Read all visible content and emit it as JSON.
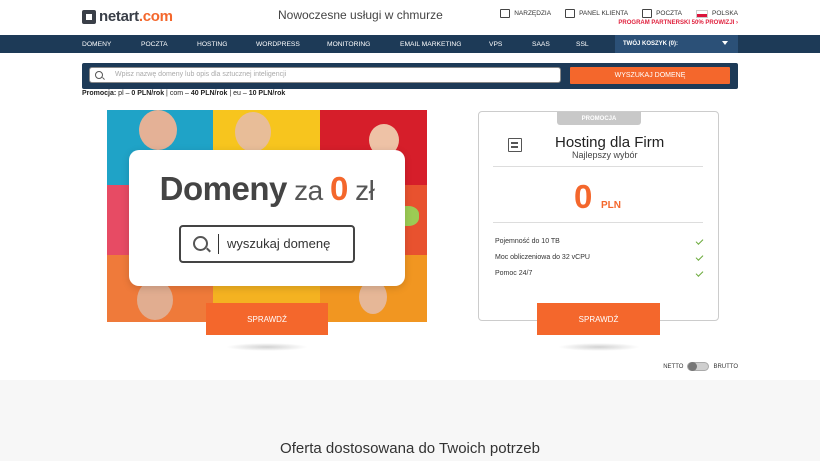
{
  "header": {
    "logo_text": "netart",
    "logo_suffix": ".com",
    "tagline": "Nowoczesne usługi w chmurze",
    "links": [
      {
        "label": "NARZĘDZIA",
        "icon": "tools-icon"
      },
      {
        "label": "PANEL KLIENTA",
        "icon": "user-icon"
      },
      {
        "label": "POCZTA",
        "icon": "mail-icon"
      },
      {
        "label": "POLSKA",
        "icon": "flag-poland-icon"
      }
    ],
    "partner_link": "PROGRAM PARTNERSKI 50% PROWIZJI ›"
  },
  "nav": {
    "items": [
      "DOMENY",
      "POCZTA",
      "HOSTING",
      "WORDPRESS",
      "MONITORING",
      "EMAIL MARKETING",
      "VPS",
      "SaaS",
      "SSL"
    ],
    "cart_label": "TWÓJ KOSZYK (0):"
  },
  "search": {
    "placeholder": "Wpisz nazwę domeny lub opis dla sztucznej inteligencji",
    "button_label": "WYSZUKAJ DOMENĘ"
  },
  "promo": {
    "label": "Promocja:",
    "text_1": " pl – ",
    "price_1": "0 PLN/rok",
    "text_2": " | com – ",
    "price_2": "40 PLN/rok",
    "text_3": " | eu – ",
    "price_3": "10 PLN/rok"
  },
  "banner": {
    "title_bold": "Domeny",
    "title_mid": " za ",
    "title_zero": "0",
    "title_unit": " zł",
    "search_text": "wyszukaj domenę",
    "button_label": "SPRAWDŹ"
  },
  "hosting": {
    "badge": "PROMOCJA",
    "title": "Hosting dla Firm",
    "subtitle": "Najlepszy wybór",
    "price": "0",
    "currency": "PLN",
    "features": [
      "Pojemność do 10 TB",
      "Moc obliczeniowa do 32 vCPU",
      "Pomoc 24/7"
    ],
    "button_label": "SPRAWDŹ"
  },
  "pricing_toggle": {
    "left": "NETTO",
    "right": "BRUTTO"
  },
  "section": {
    "title": "Oferta dostosowana do Twoich potrzeb"
  },
  "colors": {
    "accent": "#f4672c",
    "navy": "#1d3a57",
    "check": "#6aaa3a",
    "partner": "#e0233f"
  }
}
